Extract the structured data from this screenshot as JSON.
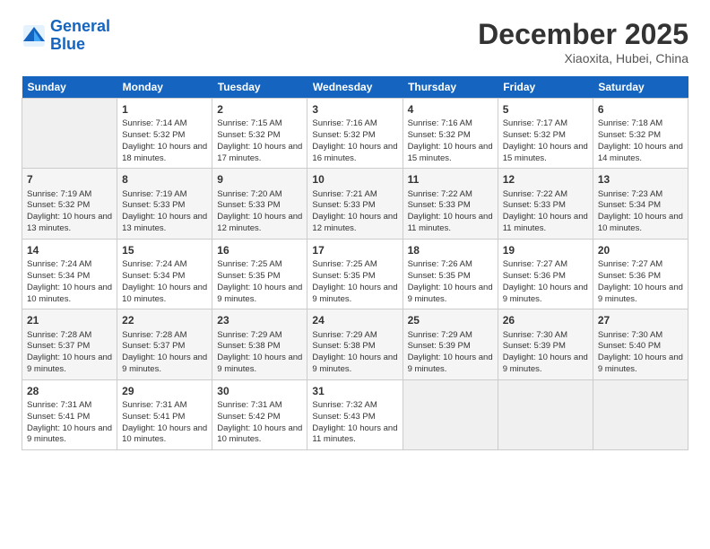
{
  "header": {
    "logo_line1": "General",
    "logo_line2": "Blue",
    "month_title": "December 2025",
    "subtitle": "Xiaoxita, Hubei, China"
  },
  "days_of_week": [
    "Sunday",
    "Monday",
    "Tuesday",
    "Wednesday",
    "Thursday",
    "Friday",
    "Saturday"
  ],
  "weeks": [
    [
      {
        "day": "",
        "empty": true
      },
      {
        "day": "1",
        "sunrise": "7:14 AM",
        "sunset": "5:32 PM",
        "daylight": "10 hours and 18 minutes."
      },
      {
        "day": "2",
        "sunrise": "7:15 AM",
        "sunset": "5:32 PM",
        "daylight": "10 hours and 17 minutes."
      },
      {
        "day": "3",
        "sunrise": "7:16 AM",
        "sunset": "5:32 PM",
        "daylight": "10 hours and 16 minutes."
      },
      {
        "day": "4",
        "sunrise": "7:16 AM",
        "sunset": "5:32 PM",
        "daylight": "10 hours and 15 minutes."
      },
      {
        "day": "5",
        "sunrise": "7:17 AM",
        "sunset": "5:32 PM",
        "daylight": "10 hours and 15 minutes."
      },
      {
        "day": "6",
        "sunrise": "7:18 AM",
        "sunset": "5:32 PM",
        "daylight": "10 hours and 14 minutes."
      }
    ],
    [
      {
        "day": "7",
        "sunrise": "7:19 AM",
        "sunset": "5:32 PM",
        "daylight": "10 hours and 13 minutes."
      },
      {
        "day": "8",
        "sunrise": "7:19 AM",
        "sunset": "5:33 PM",
        "daylight": "10 hours and 13 minutes."
      },
      {
        "day": "9",
        "sunrise": "7:20 AM",
        "sunset": "5:33 PM",
        "daylight": "10 hours and 12 minutes."
      },
      {
        "day": "10",
        "sunrise": "7:21 AM",
        "sunset": "5:33 PM",
        "daylight": "10 hours and 12 minutes."
      },
      {
        "day": "11",
        "sunrise": "7:22 AM",
        "sunset": "5:33 PM",
        "daylight": "10 hours and 11 minutes."
      },
      {
        "day": "12",
        "sunrise": "7:22 AM",
        "sunset": "5:33 PM",
        "daylight": "10 hours and 11 minutes."
      },
      {
        "day": "13",
        "sunrise": "7:23 AM",
        "sunset": "5:34 PM",
        "daylight": "10 hours and 10 minutes."
      }
    ],
    [
      {
        "day": "14",
        "sunrise": "7:24 AM",
        "sunset": "5:34 PM",
        "daylight": "10 hours and 10 minutes."
      },
      {
        "day": "15",
        "sunrise": "7:24 AM",
        "sunset": "5:34 PM",
        "daylight": "10 hours and 10 minutes."
      },
      {
        "day": "16",
        "sunrise": "7:25 AM",
        "sunset": "5:35 PM",
        "daylight": "10 hours and 9 minutes."
      },
      {
        "day": "17",
        "sunrise": "7:25 AM",
        "sunset": "5:35 PM",
        "daylight": "10 hours and 9 minutes."
      },
      {
        "day": "18",
        "sunrise": "7:26 AM",
        "sunset": "5:35 PM",
        "daylight": "10 hours and 9 minutes."
      },
      {
        "day": "19",
        "sunrise": "7:27 AM",
        "sunset": "5:36 PM",
        "daylight": "10 hours and 9 minutes."
      },
      {
        "day": "20",
        "sunrise": "7:27 AM",
        "sunset": "5:36 PM",
        "daylight": "10 hours and 9 minutes."
      }
    ],
    [
      {
        "day": "21",
        "sunrise": "7:28 AM",
        "sunset": "5:37 PM",
        "daylight": "10 hours and 9 minutes."
      },
      {
        "day": "22",
        "sunrise": "7:28 AM",
        "sunset": "5:37 PM",
        "daylight": "10 hours and 9 minutes."
      },
      {
        "day": "23",
        "sunrise": "7:29 AM",
        "sunset": "5:38 PM",
        "daylight": "10 hours and 9 minutes."
      },
      {
        "day": "24",
        "sunrise": "7:29 AM",
        "sunset": "5:38 PM",
        "daylight": "10 hours and 9 minutes."
      },
      {
        "day": "25",
        "sunrise": "7:29 AM",
        "sunset": "5:39 PM",
        "daylight": "10 hours and 9 minutes."
      },
      {
        "day": "26",
        "sunrise": "7:30 AM",
        "sunset": "5:39 PM",
        "daylight": "10 hours and 9 minutes."
      },
      {
        "day": "27",
        "sunrise": "7:30 AM",
        "sunset": "5:40 PM",
        "daylight": "10 hours and 9 minutes."
      }
    ],
    [
      {
        "day": "28",
        "sunrise": "7:31 AM",
        "sunset": "5:41 PM",
        "daylight": "10 hours and 9 minutes."
      },
      {
        "day": "29",
        "sunrise": "7:31 AM",
        "sunset": "5:41 PM",
        "daylight": "10 hours and 10 minutes."
      },
      {
        "day": "30",
        "sunrise": "7:31 AM",
        "sunset": "5:42 PM",
        "daylight": "10 hours and 10 minutes."
      },
      {
        "day": "31",
        "sunrise": "7:32 AM",
        "sunset": "5:43 PM",
        "daylight": "10 hours and 11 minutes."
      },
      {
        "day": "",
        "empty": true
      },
      {
        "day": "",
        "empty": true
      },
      {
        "day": "",
        "empty": true
      }
    ]
  ]
}
